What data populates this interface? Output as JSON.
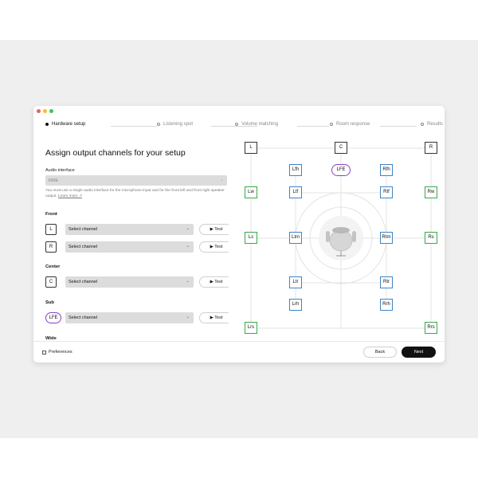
{
  "colors": {
    "close": "#f25f58",
    "minimize": "#f9be2f",
    "zoom": "#3cc84a",
    "lfe": "#8a3fc4",
    "height": "#3c84c8",
    "surround": "#38a84a"
  },
  "stepper": {
    "steps": [
      {
        "label": "Hardware setup",
        "active": true
      },
      {
        "label": "Listening spot",
        "active": false
      },
      {
        "label": "Volume matching",
        "active": false
      },
      {
        "label": "Room response",
        "active": false
      },
      {
        "label": "Results",
        "active": false
      }
    ]
  },
  "setup": {
    "title": "Assign output channels for your setup",
    "interface_label": "Audio interface",
    "interface_value": "RME",
    "note": "You must use a single audio interface for the microphone input and for the front left and front right speaker output.",
    "learn_more": "Learn more ↗",
    "sections": {
      "front": "Front",
      "center": "Center",
      "sub": "Sub",
      "wide": "Wide"
    },
    "rows": [
      {
        "channel": "L",
        "select": "Select channel",
        "test": "▶ Test"
      },
      {
        "channel": "R",
        "select": "Select channel",
        "test": "▶ Test"
      },
      {
        "channel": "C",
        "select": "Select channel",
        "test": "▶ Test"
      },
      {
        "channel": "LFE",
        "select": "Select channel",
        "test": "▶ Test"
      }
    ]
  },
  "diagram": {
    "speakers": {
      "L": "L",
      "C": "C",
      "R": "R",
      "Lfh": "Lfh",
      "LFE": "LFE",
      "Rfh": "Rfh",
      "Lw": "Lw",
      "Ltf": "Ltf",
      "Rtf": "Rtf",
      "Rw": "Rw",
      "Ls": "Ls",
      "Ltm": "Ltm",
      "Rtm": "Rtm",
      "Rs": "Rs",
      "Ltr": "Ltr",
      "Rtr": "Rtr",
      "Lrh": "Lrh",
      "Rrh": "Rrh",
      "Lrs": "Lrs",
      "Rrs": "Rrs"
    }
  },
  "footer": {
    "preferences": "Preferences",
    "back": "Back",
    "next": "Next"
  }
}
